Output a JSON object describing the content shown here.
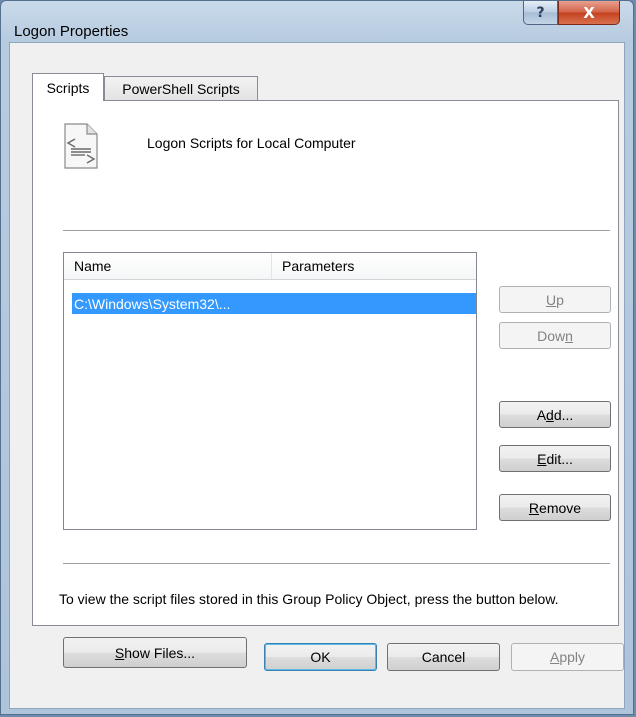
{
  "window": {
    "title": "Logon Properties",
    "help_glyph": "?",
    "close_glyph": "X"
  },
  "tabs": [
    {
      "label": "Scripts",
      "selected": true
    },
    {
      "label": "PowerShell Scripts",
      "selected": false
    }
  ],
  "panel": {
    "heading": "Logon Scripts for Local Computer",
    "list": {
      "columns": [
        "Name",
        "Parameters"
      ],
      "rows": [
        {
          "name": "C:\\Windows\\System32\\...",
          "parameters": "",
          "selected": true
        }
      ]
    },
    "buttons": {
      "up": {
        "label": "Up",
        "accel": "U",
        "enabled": false
      },
      "down": {
        "label": "Down",
        "accel": "n",
        "enabled": false
      },
      "add": {
        "label": "Add...",
        "accel": "d",
        "enabled": true
      },
      "edit": {
        "label": "Edit...",
        "accel": "E",
        "enabled": true
      },
      "remove": {
        "label": "Remove",
        "accel": "R",
        "enabled": true
      }
    },
    "info_text": "To view the script files stored in this Group Policy Object, press the button below.",
    "show_files": {
      "label": "Show Files...",
      "accel": "S"
    }
  },
  "footer": {
    "ok": "OK",
    "cancel": "Cancel",
    "apply": "Apply",
    "apply_accel": "A"
  },
  "colors": {
    "selection": "#3399ff",
    "close_button": "#c2401f",
    "disabled_text": "#838383"
  }
}
